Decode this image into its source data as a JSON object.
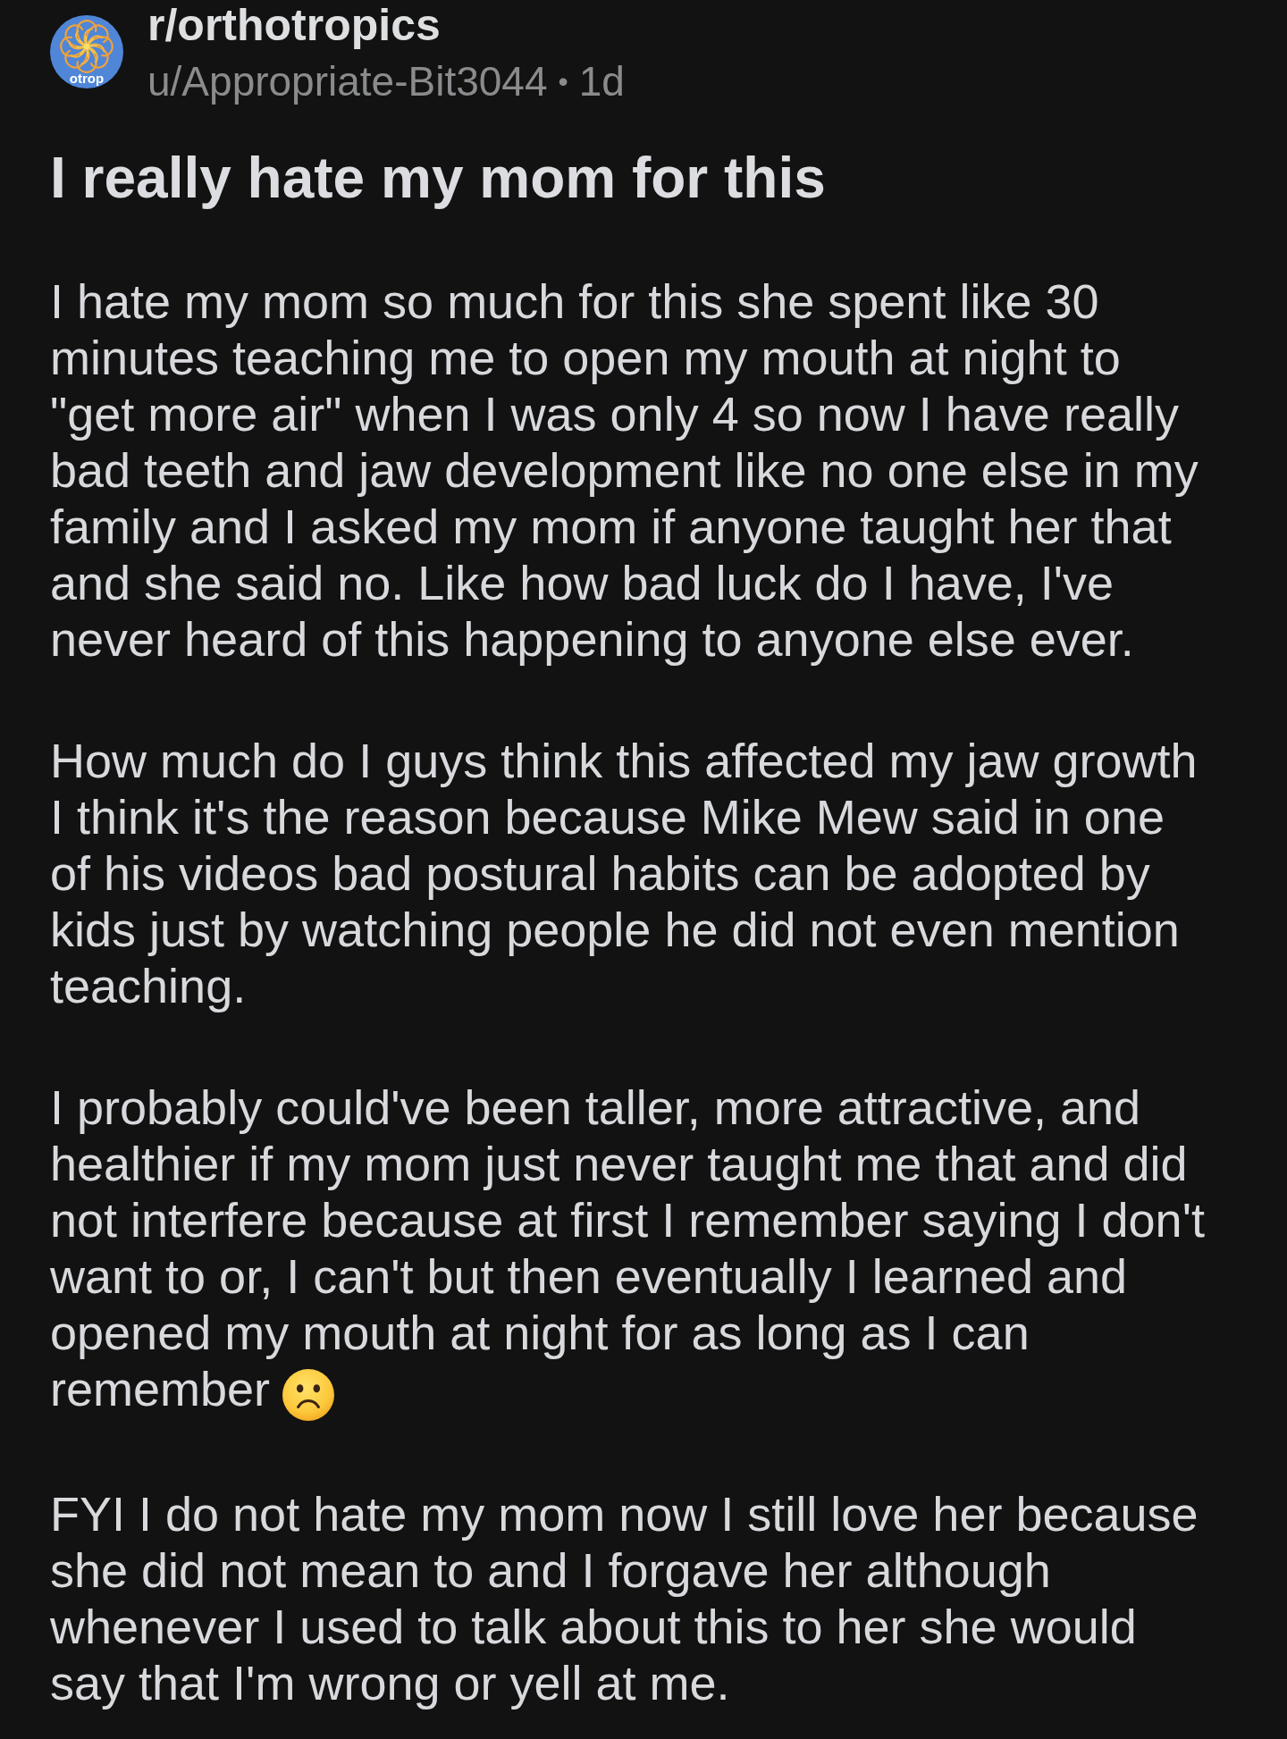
{
  "post": {
    "subreddit": "r/orthotropics",
    "avatar_label": "otrop",
    "author": "u/Appropriate-Bit3044",
    "separator": "•",
    "age": "1d",
    "title": "I really hate my mom for this",
    "paragraphs": [
      {
        "text": "I hate my mom so much for this she spent like 30 minutes teaching me to open my mouth at night to \"get more air\" when I was only 4 so now I have really bad teeth and jaw development like no one else in my family and I asked my mom if anyone taught her that and she said no. Like how bad luck do I have, I've never heard of this happening to anyone else ever.",
        "emoji": false
      },
      {
        "text": "How much do I guys think this affected my jaw growth I think it's the reason because Mike Mew said in one of his videos bad postural habits can be adopted by kids just by watching people he did not even mention teaching.",
        "emoji": false
      },
      {
        "text": "I probably could've been taller, more attractive, and healthier if my mom just never taught me that and did not interfere because at first I remember saying I don't want to or, I can't but then eventually I learned and opened my mouth at night for as long as I can remember",
        "emoji": true
      },
      {
        "text": "FYI I do not hate my mom now I still love her because she did not mean to and I forgave her although whenever I used to talk about this to her she would say that I'm wrong or yell at me.",
        "emoji": false
      }
    ]
  }
}
